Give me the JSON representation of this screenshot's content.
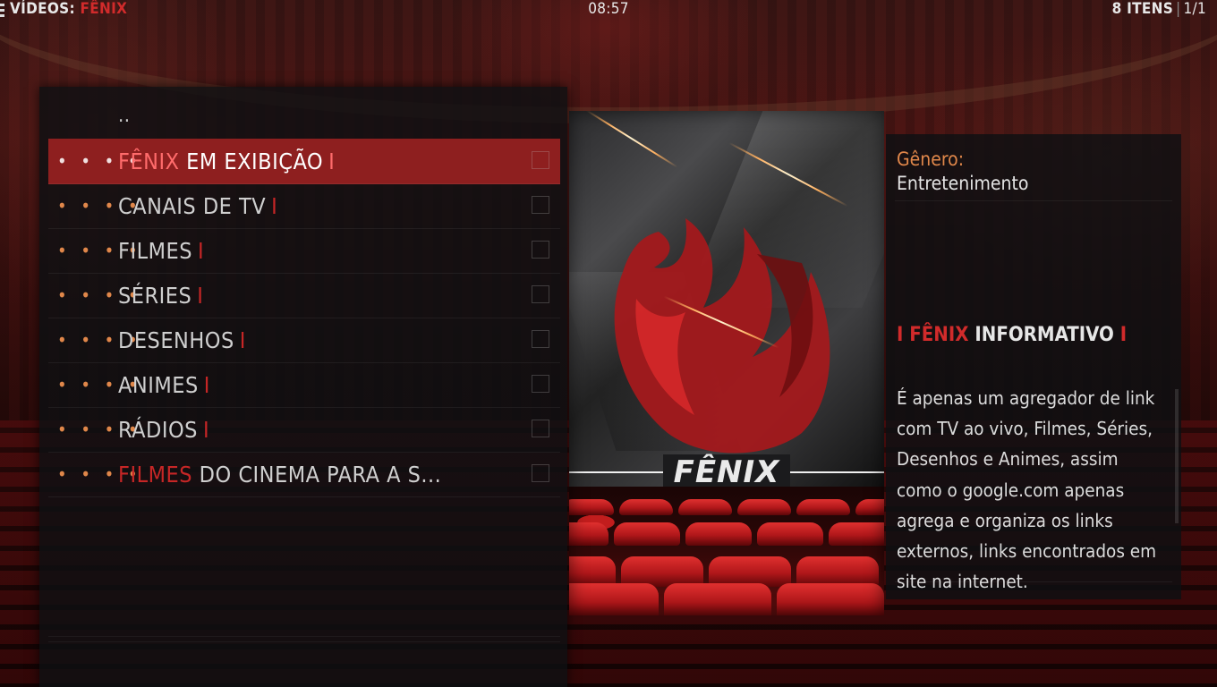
{
  "header": {
    "section": "VÍDEOS:",
    "addon": "FÊNIX",
    "time": "08:57",
    "item_count": "8 ITENS",
    "pages": "1/1"
  },
  "list": {
    "parent_label": "..",
    "items": [
      {
        "prefix": "FÊNIX",
        "text": "EM EXIBIÇÃO",
        "bar": "I",
        "selected": true
      },
      {
        "prefix": "",
        "text": "CANAIS DE TV",
        "bar": "I"
      },
      {
        "prefix": "",
        "text": "FILMES",
        "bar": "I"
      },
      {
        "prefix": "",
        "text": "SÉRIES",
        "bar": "I"
      },
      {
        "prefix": "",
        "text": "DESENHOS",
        "bar": "I"
      },
      {
        "prefix": "",
        "text": "ANIMES",
        "bar": "I"
      },
      {
        "prefix": "",
        "text": "RÁDIOS",
        "bar": "I"
      },
      {
        "prefix": "FILMES",
        "text": "DO CINEMA PARA A S...",
        "bar": ""
      }
    ],
    "dots": "• • • •"
  },
  "poster": {
    "title": "FÊNIX"
  },
  "info": {
    "genre_label": "Gênero:",
    "genre_value": "Entretenimento",
    "title_bar_left": "I",
    "title_accent": "FÊNIX",
    "title_text": "INFORMATIVO",
    "title_bar_right": "I",
    "description": "É apenas um agregador de link com TV ao vivo, Filmes, Séries, Desenhos e Animes, assim como o google.com apenas agrega e organiza os links externos, links encontrados em site na internet."
  },
  "colors": {
    "accent_red": "#c62626",
    "selected_row": "#8e1f1f",
    "dots_orange": "#e0874a"
  }
}
